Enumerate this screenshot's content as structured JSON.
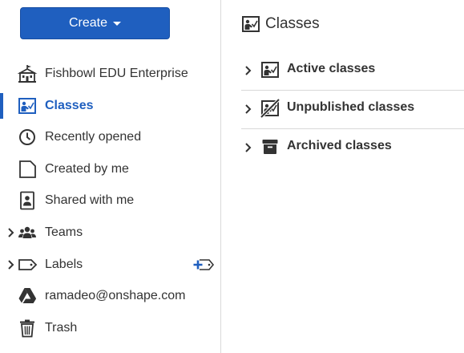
{
  "sidebar": {
    "create_label": "Create",
    "items": [
      {
        "label": "Fishbowl EDU Enterprise",
        "icon": "school-icon"
      },
      {
        "label": "Classes",
        "icon": "classroom-icon",
        "active": true
      },
      {
        "label": "Recently opened",
        "icon": "clock-icon"
      },
      {
        "label": "Created by me",
        "icon": "document-icon"
      },
      {
        "label": "Shared with me",
        "icon": "shared-user-icon"
      },
      {
        "label": "Teams",
        "icon": "team-icon",
        "expandable": true
      },
      {
        "label": "Labels",
        "icon": "label-tag-icon",
        "expandable": true
      },
      {
        "label": "ramadeo@onshape.com",
        "icon": "google-drive-icon"
      },
      {
        "label": "Trash",
        "icon": "trash-icon"
      }
    ]
  },
  "main": {
    "title": "Classes",
    "folders": [
      {
        "label": "Active classes",
        "icon": "classroom-icon"
      },
      {
        "label": "Unpublished classes",
        "icon": "classroom-unpublished-icon"
      },
      {
        "label": "Archived classes",
        "icon": "archive-box-icon"
      }
    ]
  },
  "colors": {
    "accent": "#1f5fbf",
    "text": "#333333",
    "divider": "#d9d9d9"
  }
}
